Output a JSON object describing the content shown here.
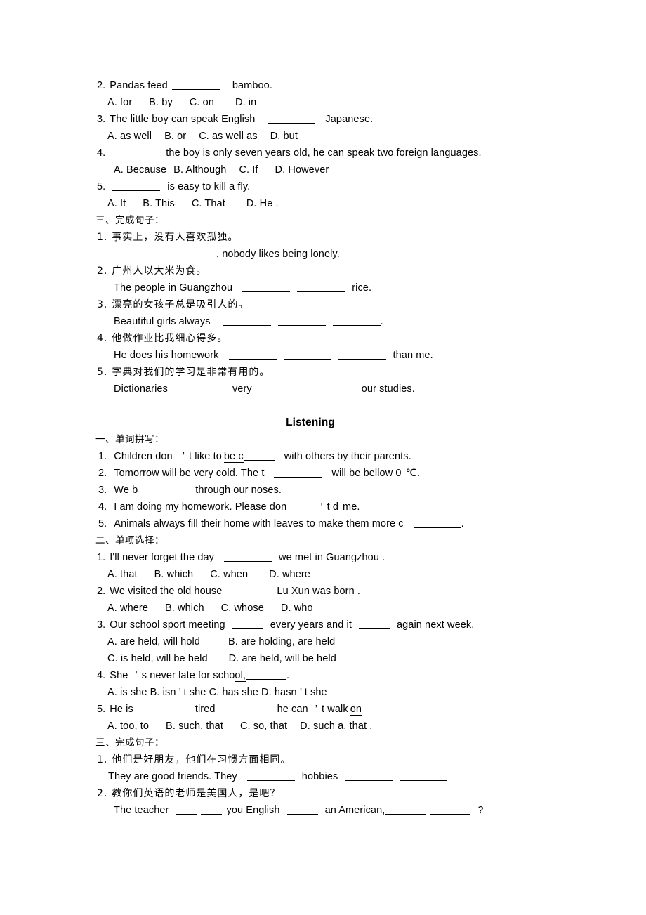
{
  "document": {
    "type": "english-exam-worksheet",
    "language": "zh-CN/en",
    "blank_marker": "________"
  },
  "section_top": {
    "questions": [
      {
        "number": "2.",
        "stem_before": "Pandas feed",
        "stem_after": "bamboo.",
        "options": [
          "A. for",
          "B. by",
          "C. on",
          "D. in"
        ]
      },
      {
        "number": "3.",
        "stem_before": "The little boy can speak English",
        "stem_after": "Japanese.",
        "options": [
          "A. as well",
          "B. or",
          "C. as well as",
          "D. but"
        ]
      },
      {
        "number": "4.",
        "stem_before": "",
        "stem_after": "the boy is only seven years old, he can speak two foreign languages.",
        "options": [
          "A. Because",
          "B. Although",
          "C. If",
          "D. However"
        ]
      },
      {
        "number": "5.",
        "stem_before": "",
        "stem_after": "is easy to kill a fly.",
        "options": [
          "A. It",
          "B. This",
          "C. That",
          "D. He ."
        ]
      }
    ]
  },
  "section_three_top": {
    "header": "三、完成句子：",
    "items": [
      {
        "number": "1.",
        "chinese": "事实上，没有人喜欢孤独。",
        "english_before": "",
        "english_mid": "",
        "english_after": ", nobody likes being lonely."
      },
      {
        "number": "2.",
        "chinese": "广州人以大米为食。",
        "english_before": "The people in Guangzhou",
        "english_mid": "",
        "english_after": "rice."
      },
      {
        "number": "3.",
        "chinese": "漂亮的女孩子总是吸引人的。",
        "english_before": "Beautiful girls always",
        "english_mid": "",
        "english_after": "."
      },
      {
        "number": "4.",
        "chinese": "他做作业比我细心得多。",
        "english_before": "He does his homework",
        "english_mid": "",
        "english_after": "than me."
      },
      {
        "number": "5.",
        "chinese": "字典对我们的学习是非常有用的。",
        "english_before": "Dictionaries",
        "english_mid": "very",
        "english_after": "our studies."
      }
    ]
  },
  "listening": {
    "title": "Listening",
    "part_one": {
      "header": "一、单词拼写：",
      "items": [
        {
          "number": "1.",
          "text_a": "Children don",
          "apostrophe": "’",
          "text_b": "t like to",
          "underlined_hint": "be c",
          "text_c": "with others by their parents."
        },
        {
          "number": "2.",
          "text_a": "Tomorrow will be very cold. The t",
          "text_c": "will be bellow 0",
          "degree": "℃",
          "text_d": "."
        },
        {
          "number": "3.",
          "text_a": "We b",
          "text_c": "through our noses."
        },
        {
          "number": "4.",
          "text_a": "I am doing my homework. Please don",
          "apostrophe": "’",
          "underlined_hint": "t d",
          "text_c": "me."
        },
        {
          "number": "5.",
          "text_a": "Animals always fill their home with leaves to make them more c",
          "text_c": "."
        }
      ]
    },
    "part_two": {
      "header": "二、单项选择：",
      "questions": [
        {
          "number": "1.",
          "stem_before": "I'll never forget the day",
          "stem_after": "we met in Guangzhou .",
          "options": [
            "A. that",
            "B. which",
            "C. when",
            "D. where"
          ]
        },
        {
          "number": "2.",
          "stem_before": "We visited the old house",
          "stem_after": "Lu Xun was born .",
          "options": [
            "A. where",
            "B. which",
            "C. whose",
            "D. who"
          ]
        },
        {
          "number": "3.",
          "stem_before": "Our school sport meeting",
          "stem_mid": "every years and it",
          "stem_after": "again next week.",
          "options_row1": [
            "A. are held, will hold",
            "B. are holding, are held"
          ],
          "options_row2": [
            "C. is held, will be held",
            "D. are held, will be held"
          ]
        },
        {
          "number": "4.",
          "stem_before": "She",
          "apostrophe": "’",
          "stem_mid": "s never late for scho",
          "stem_underlined": "ol,",
          "stem_after": ".",
          "options": [
            "A. is she",
            "B. isn",
            "t she C. has she",
            "D. hasn",
            "t she"
          ],
          "options_text": "A. is she      B. isn ’ t she C. has she      D. hasn ’ t she"
        },
        {
          "number": "5.",
          "stem_before": "He is",
          "stem_mid": "tired",
          "stem_after": "he can",
          "apostrophe": "’",
          "stem_tail": "t walk",
          "stem_underlined": "on",
          "options": [
            "A. too, to",
            "B. such, that",
            "C. so, that",
            "D. such a, that ."
          ]
        }
      ]
    },
    "part_three": {
      "header": "三、完成句子：",
      "items": [
        {
          "number": "1.",
          "chinese": "他们是好朋友，他们在习惯方面相同。",
          "english_before": "They are good friends. They",
          "english_mid": "hobbies",
          "english_after": ""
        },
        {
          "number": "2.",
          "chinese": "教你们英语的老师是美国人，是吧？",
          "english_before": "The teacher",
          "english_mid": "you English",
          "english_mid2": "an American,",
          "english_after": "?"
        }
      ]
    }
  }
}
